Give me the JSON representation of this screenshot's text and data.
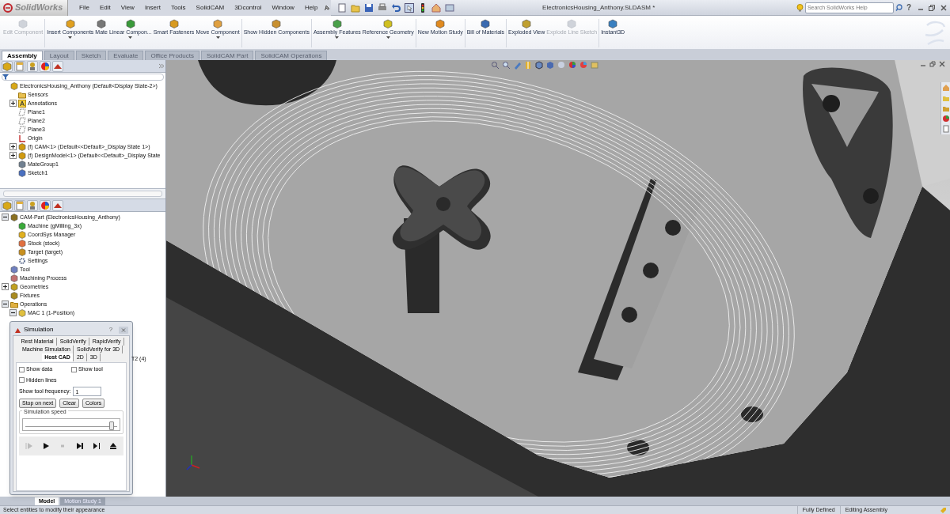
{
  "title_bar": {
    "logo": "SolidWorks",
    "menus": [
      "File",
      "Edit",
      "View",
      "Insert",
      "Tools",
      "SolidCAM",
      "3Dcontrol",
      "Window",
      "Help"
    ],
    "document_title": "ElectronicsHousing_Anthony.SLDASM *",
    "search": {
      "placeholder": "Search SolidWorks Help"
    },
    "help": "?"
  },
  "commands": [
    {
      "label": "Edit Component",
      "disabled": true,
      "dropdown": false
    },
    {
      "label": "Insert Components",
      "disabled": false,
      "dropdown": true
    },
    {
      "label": "Mate",
      "disabled": false,
      "dropdown": false
    },
    {
      "label": "Linear Compon...",
      "disabled": false,
      "dropdown": true
    },
    {
      "label": "Smart Fasteners",
      "disabled": false,
      "dropdown": false
    },
    {
      "label": "Move Component",
      "disabled": false,
      "dropdown": true
    },
    {
      "label": "Show Hidden Components",
      "disabled": false,
      "dropdown": false
    },
    {
      "label": "Assembly Features",
      "disabled": false,
      "dropdown": true
    },
    {
      "label": "Reference Geometry",
      "disabled": false,
      "dropdown": true
    },
    {
      "label": "New Motion Study",
      "disabled": false,
      "dropdown": false
    },
    {
      "label": "Bill of Materials",
      "disabled": false,
      "dropdown": false
    },
    {
      "label": "Exploded View",
      "disabled": false,
      "dropdown": false
    },
    {
      "label": "Explode Line Sketch",
      "disabled": true,
      "dropdown": false
    },
    {
      "label": "Instant3D",
      "disabled": false,
      "dropdown": false
    }
  ],
  "command_tabs": [
    {
      "label": "Assembly",
      "selected": true
    },
    {
      "label": "Layout",
      "selected": false
    },
    {
      "label": "Sketch",
      "selected": false
    },
    {
      "label": "Evaluate",
      "selected": false
    },
    {
      "label": "Office Products",
      "selected": false
    },
    {
      "label": "SolidCAM Part",
      "selected": false
    },
    {
      "label": "SolidCAM Operations",
      "selected": false
    }
  ],
  "feature_tree": {
    "items": [
      {
        "kind": "assembly",
        "label": "ElectronicsHousing_Anthony  (Default<Display State-2>)",
        "children": [
          {
            "kind": "sensors",
            "label": "Sensors"
          },
          {
            "kind": "annotations",
            "label": "Annotations",
            "expanded": false
          },
          {
            "kind": "plane",
            "label": "Plane1"
          },
          {
            "kind": "plane",
            "label": "Plane2"
          },
          {
            "kind": "plane",
            "label": "Plane3"
          },
          {
            "kind": "origin",
            "label": "Origin"
          },
          {
            "kind": "component",
            "label": "(f) CAM<1> (Default<<Default>_Display State 1>)",
            "expanded": false
          },
          {
            "kind": "component",
            "label": "(f) DesignModel<1> (Default<<Default>_Display State",
            "expanded": false
          },
          {
            "kind": "mates",
            "label": "MateGroup1"
          },
          {
            "kind": "sketch",
            "label": "Sketch1"
          }
        ]
      }
    ]
  },
  "cam_tree": {
    "items": [
      {
        "kind": "campart",
        "label": "CAM-Part (ElectronicsHousing_Anthony)",
        "expanded": true,
        "children": [
          {
            "kind": "machine",
            "label": "Machine (gMilling_3x)"
          },
          {
            "kind": "coordsys",
            "label": "CoordSys Manager"
          },
          {
            "kind": "stock",
            "label": "Stock (stock)"
          },
          {
            "kind": "target",
            "label": "Target (target)"
          },
          {
            "kind": "settings",
            "label": "Settings"
          }
        ]
      },
      {
        "kind": "tool",
        "label": "Tool"
      },
      {
        "kind": "process",
        "label": "Machining Process"
      },
      {
        "kind": "geometries",
        "label": "Geometries",
        "expanded": false
      },
      {
        "kind": "fixtures",
        "label": "Fixtures"
      },
      {
        "kind": "folder",
        "label": "Operations",
        "expanded": true,
        "children": [
          {
            "kind": "operation",
            "label": "MAC 1 (1-Position)",
            "expanded": true
          }
        ]
      }
    ]
  },
  "partial_row_label": "T2 (4)",
  "simulation": {
    "title": "Simulation",
    "help": "?",
    "tab_rows": [
      [
        {
          "label": "Rest Material",
          "selected": false
        },
        {
          "label": "SolidVerify",
          "selected": false
        },
        {
          "label": "RapidVerify",
          "selected": false
        }
      ],
      [
        {
          "label": "Machine Simulation",
          "selected": false
        },
        {
          "label": "SolidVerify for 3D",
          "selected": false
        }
      ],
      [
        {
          "label": "Host CAD",
          "selected": true
        },
        {
          "label": "2D",
          "selected": false
        },
        {
          "label": "3D",
          "selected": false
        }
      ]
    ],
    "checkboxes": [
      {
        "label": "Show data",
        "checked": false
      },
      {
        "label": "Show tool",
        "checked": false
      },
      {
        "label": "Hidden lines",
        "checked": false
      }
    ],
    "frequency": {
      "label": "Show tool frequency:",
      "value": "1"
    },
    "buttons": [
      "Stop on next",
      "Clear",
      "Colors"
    ],
    "speed": {
      "label": "Simulation speed",
      "level": 0.95
    },
    "playback": [
      {
        "kind": "step_play",
        "disabled": true
      },
      {
        "kind": "play",
        "disabled": false
      },
      {
        "kind": "stop",
        "disabled": true
      },
      {
        "kind": "to_end",
        "disabled": false
      },
      {
        "kind": "step",
        "disabled": false
      },
      {
        "kind": "eject",
        "disabled": false
      }
    ]
  },
  "bottom_tabs": [
    {
      "label": "Model",
      "selected": true
    },
    {
      "label": "Motion Study 1",
      "selected": false
    }
  ],
  "status_bar": {
    "message": "Select entities to modify their appearance",
    "items": [
      "Fully Defined",
      "Editing Assembly"
    ]
  }
}
